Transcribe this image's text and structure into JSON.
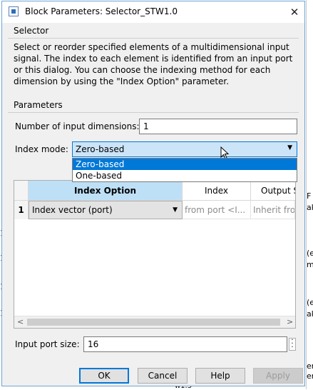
{
  "dialog": {
    "title": "Block Parameters: Selector_STW1.0",
    "close_glyph": "✕",
    "group_selector": "Selector",
    "description": "Select or reorder specified elements of a multidimensional input signal. The index to each element is identified from an input port or this dialog. You can choose the indexing method for each dimension by using the \"Index Option\" parameter.",
    "group_parameters": "Parameters",
    "num_dims_label": "Number of input dimensions:",
    "num_dims_value": "1",
    "index_mode_label": "Index mode:",
    "index_mode_value": "Zero-based",
    "index_mode_options": [
      "Zero-based",
      "One-based"
    ],
    "table": {
      "headers": [
        "Index Option",
        "Index",
        "Output S"
      ],
      "rows": [
        {
          "num": "1",
          "option": "Index vector (port)",
          "index": "from port <I...",
          "output": "Inherit from"
        }
      ]
    },
    "input_port_label": "Input port size:",
    "input_port_value": "16",
    "buttons": {
      "ok": "OK",
      "cancel": "Cancel",
      "help": "Help",
      "apply": "Apply"
    }
  },
  "background": {
    "right_fragments": [
      "F",
      "ak",
      "(e",
      "m",
      "(e",
      "ak",
      "er",
      "era"
    ],
    "left_numbers": [
      "1",
      "1",
      "1",
      "1"
    ],
    "bottom_label": "w1.3"
  },
  "colors": {
    "accent": "#0078d7",
    "header_highlight": "#bee0f7",
    "combo_focus": "#cce4f7"
  }
}
